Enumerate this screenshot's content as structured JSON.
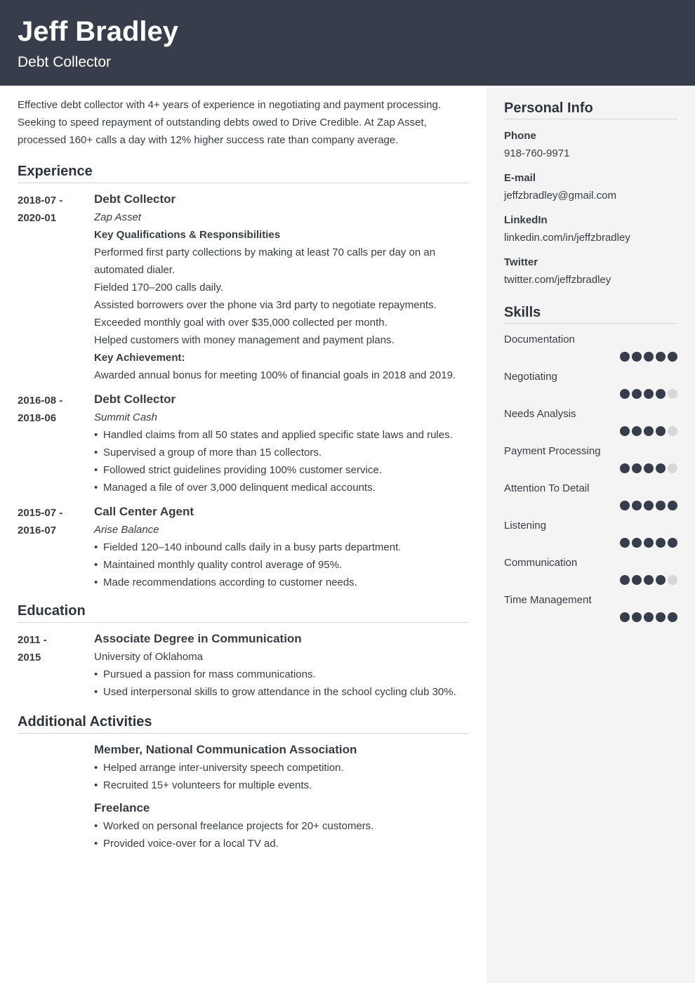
{
  "header": {
    "name": "Jeff Bradley",
    "title": "Debt Collector"
  },
  "summary": "Effective debt collector with 4+ years of experience in negotiating and payment processing. Seeking to speed repayment of outstanding debts owed to Drive Credible. At Zap Asset, processed 160+ calls a day with 12% higher success rate than company average.",
  "experience": {
    "title": "Experience",
    "entries": [
      {
        "dates_start": "2018-07 -",
        "dates_end": "2020-01",
        "role": "Debt Collector",
        "company": "Zap Asset",
        "sub1": "Key Qualifications & Responsibilities",
        "lines": [
          "Performed first party collections by making at least 70 calls per day on an automated dialer.",
          "Fielded 170–200 calls daily.",
          "Assisted borrowers over the phone via 3rd party to negotiate repayments.",
          "Exceeded monthly goal with over $35,000 collected per month.",
          "Helped customers with money management and payment plans."
        ],
        "sub2": "Key Achievement:",
        "achievement": "Awarded annual bonus for meeting 100% of financial goals in 2018 and 2019."
      },
      {
        "dates_start": "2016-08 -",
        "dates_end": "2018-06",
        "role": "Debt Collector",
        "company": "Summit Cash",
        "bullets": [
          "Handled claims from all 50 states and applied specific state laws and rules.",
          "Supervised a group of more than 15 collectors.",
          "Followed strict guidelines providing 100% customer service.",
          "Managed a file of over 3,000 delinquent medical accounts."
        ]
      },
      {
        "dates_start": "2015-07 -",
        "dates_end": "2016-07",
        "role": "Call Center Agent",
        "company": "Arise Balance",
        "bullets": [
          "Fielded 120–140 inbound calls daily in a busy parts department.",
          "Maintained monthly quality control average of 95%.",
          "Made recommendations according to customer needs."
        ]
      }
    ]
  },
  "education": {
    "title": "Education",
    "entries": [
      {
        "dates_start": "2011 -",
        "dates_end": "2015",
        "degree": "Associate Degree in Communication",
        "school": "University of Oklahoma",
        "bullets": [
          "Pursued a passion for mass communications.",
          "Used interpersonal skills to grow attendance in the school cycling club 30%."
        ]
      }
    ]
  },
  "activities": {
    "title": "Additional Activities",
    "entries": [
      {
        "title": "Member, National Communication Association",
        "bullets": [
          "Helped arrange inter-university speech competition.",
          "Recruited 15+ volunteers for multiple events."
        ]
      },
      {
        "title": "Freelance",
        "bullets": [
          "Worked on personal freelance projects for 20+ customers.",
          "Provided voice-over for a local TV ad."
        ]
      }
    ]
  },
  "personal_info": {
    "title": "Personal Info",
    "items": [
      {
        "label": "Phone",
        "value": "918-760-9971"
      },
      {
        "label": "E-mail",
        "value": "jeffzbradley@gmail.com"
      },
      {
        "label": "LinkedIn",
        "value": "linkedin.com/in/jeffzbradley"
      },
      {
        "label": "Twitter",
        "value": "twitter.com/jeffzbradley"
      }
    ]
  },
  "skills": {
    "title": "Skills",
    "max_rating": 5,
    "items": [
      {
        "name": "Documentation",
        "rating": 5
      },
      {
        "name": "Negotiating",
        "rating": 4
      },
      {
        "name": "Needs Analysis",
        "rating": 4
      },
      {
        "name": "Payment Processing",
        "rating": 4
      },
      {
        "name": "Attention To Detail",
        "rating": 5
      },
      {
        "name": "Listening",
        "rating": 5
      },
      {
        "name": "Communication",
        "rating": 4
      },
      {
        "name": "Time Management",
        "rating": 5
      }
    ]
  },
  "colors": {
    "header_bg": "#373d4a",
    "sidebar_bg": "#f4f4f4",
    "dot_filled": "#373d4a",
    "dot_empty": "#d8d8d8",
    "text": "#383d45"
  }
}
